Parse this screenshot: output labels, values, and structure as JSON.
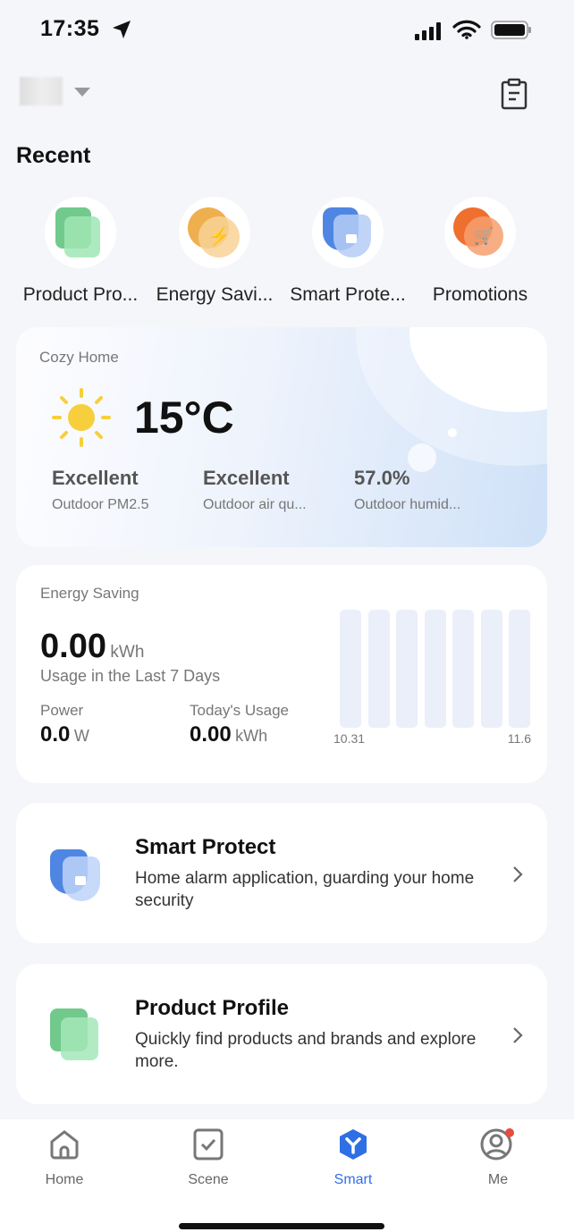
{
  "status_bar": {
    "time": "17:35"
  },
  "header": {
    "icons": [
      "caret-down-icon",
      "clipboard-icon"
    ]
  },
  "recent": {
    "title": "Recent",
    "items": [
      {
        "label": "Product Pro...",
        "icon": "product-profile-icon",
        "color": "#6fcf8f"
      },
      {
        "label": "Energy Savi...",
        "icon": "energy-bolt-icon",
        "color": "#f0b85a"
      },
      {
        "label": "Smart Prote...",
        "icon": "shield-camera-icon",
        "color": "#5b8fe8"
      },
      {
        "label": "Promotions",
        "icon": "cart-icon",
        "color": "#f07a3c"
      }
    ]
  },
  "weather": {
    "home": "Cozy Home",
    "temperature": "15°C",
    "icon": "sun-icon",
    "stats": [
      {
        "value": "Excellent",
        "label": "Outdoor PM2.5"
      },
      {
        "value": "Excellent",
        "label": "Outdoor air qu..."
      },
      {
        "value": "57.0%",
        "label": "Outdoor humid..."
      }
    ]
  },
  "energy": {
    "title": "Energy Saving",
    "total": "0.00",
    "total_unit": "kWh",
    "total_label": "Usage in the Last 7 Days",
    "power_label": "Power",
    "power_value": "0.0",
    "power_unit": "W",
    "today_label": "Today's Usage",
    "today_value": "0.00",
    "today_unit": "kWh"
  },
  "chart_data": {
    "type": "bar",
    "x_tick_labels": [
      "10.31",
      "11.6"
    ],
    "values": [
      0,
      0,
      0,
      0,
      0,
      0,
      0
    ],
    "bar_color": "#ebeffa"
  },
  "features": [
    {
      "title": "Smart Protect",
      "desc": "Home alarm application, guarding your home security",
      "icon": "shield-camera-icon"
    },
    {
      "title": "Product Profile",
      "desc": "Quickly find products and brands and explore more.",
      "icon": "product-profile-icon"
    }
  ],
  "tabs": [
    {
      "label": "Home"
    },
    {
      "label": "Scene"
    },
    {
      "label": "Smart",
      "active": true
    },
    {
      "label": "Me",
      "badge": true
    }
  ],
  "colors": {
    "accent": "#2f6fe4",
    "badge": "#e84c3d"
  }
}
